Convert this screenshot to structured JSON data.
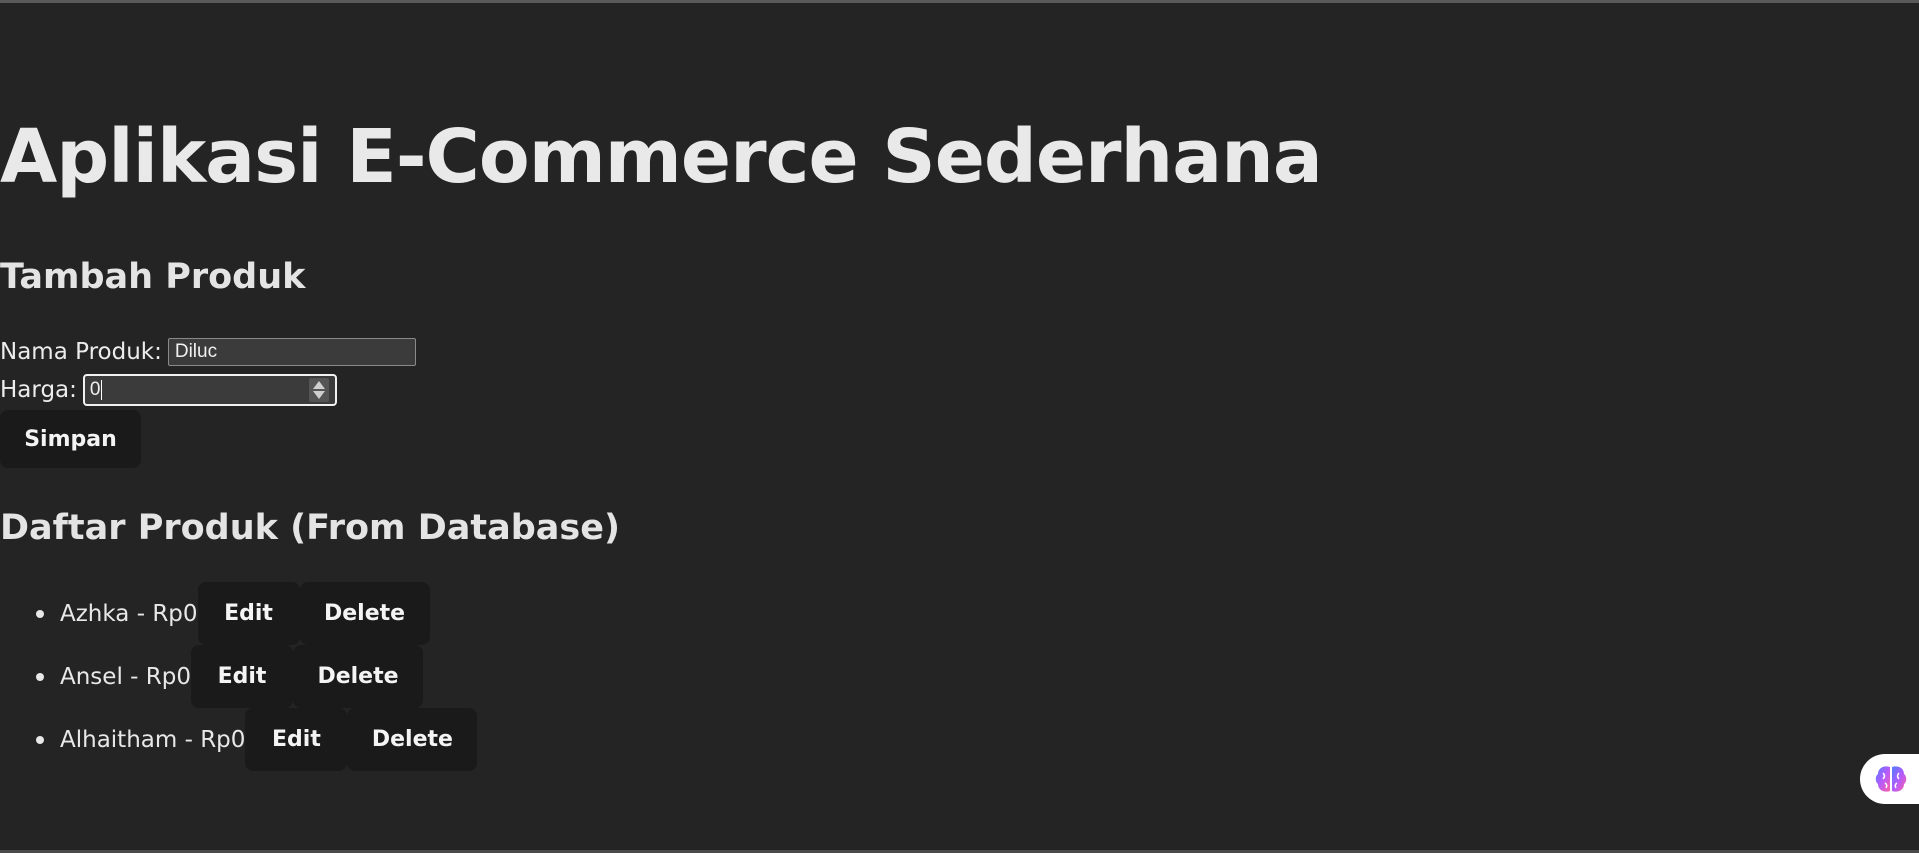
{
  "page": {
    "title": "Aplikasi E-Commerce Sederhana"
  },
  "add_section": {
    "heading": "Tambah Produk",
    "name_label": "Nama Produk:",
    "name_value": "Diluc",
    "price_label": "Harga:",
    "price_value": "0",
    "save_label": "Simpan"
  },
  "list_section": {
    "heading": "Daftar Produk (From Database)",
    "items": [
      {
        "text": "Azhka - Rp0",
        "edit_label": "Edit",
        "delete_label": "Delete"
      },
      {
        "text": "Ansel - Rp0",
        "edit_label": "Edit",
        "delete_label": "Delete"
      },
      {
        "text": "Alhaitham - Rp0",
        "edit_label": "Edit",
        "delete_label": "Delete"
      }
    ]
  },
  "extension": {
    "icon": "brain-icon"
  },
  "colors": {
    "background": "#242424",
    "button": "#1a1a1a",
    "text": "#e9e9e9"
  }
}
